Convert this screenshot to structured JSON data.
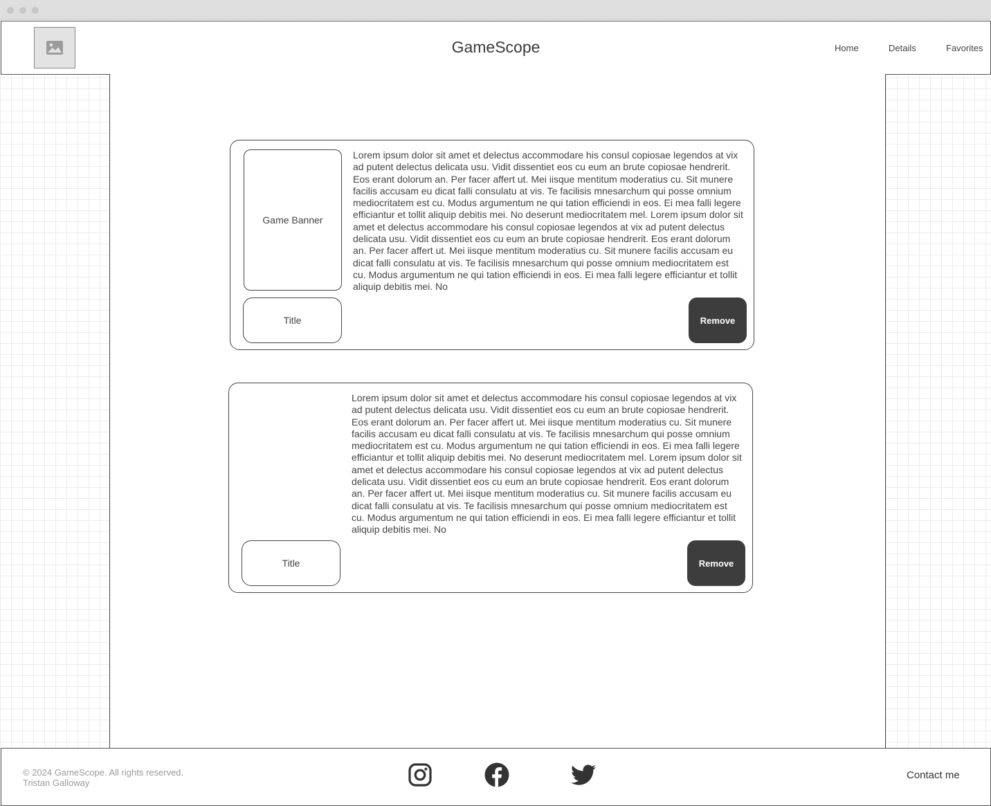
{
  "header": {
    "brand": "GameScope",
    "nav": [
      "Home",
      "Details",
      "Favorites"
    ]
  },
  "cards": [
    {
      "banner_label": "Game Banner",
      "title_label": "Title",
      "description": "Lorem ipsum dolor sit amet et delectus accommodare his consul copiosae legendos at vix ad putent delectus delicata usu. Vidit dissentiet eos cu eum an brute copiosae hendrerit. Eos erant dolorum an. Per facer affert ut. Mei iisque mentitum moderatius cu. Sit munere facilis accusam eu dicat falli consulatu at vis. Te facilisis mnesarchum qui posse omnium mediocritatem est cu. Modus argumentum ne qui tation efficiendi in eos. Ei mea falli legere efficiantur et tollit aliquip debitis mei. No deserunt mediocritatem mel. Lorem ipsum dolor sit amet et delectus accommodare his consul copiosae legendos at vix ad putent delectus delicata usu. Vidit dissentiet eos cu eum an brute copiosae hendrerit. Eos erant dolorum an. Per facer affert ut. Mei iisque mentitum moderatius cu. Sit munere facilis accusam eu dicat falli consulatu at vis. Te facilisis mnesarchum qui posse omnium mediocritatem est cu. Modus argumentum ne qui tation efficiendi in eos. Ei mea falli legere efficiantur et tollit aliquip debitis mei. No",
      "remove_label": "Remove"
    },
    {
      "title_label": "Title",
      "description": "Lorem ipsum dolor sit amet et delectus accommodare his consul copiosae legendos at vix ad putent delectus delicata usu. Vidit dissentiet eos cu eum an brute copiosae hendrerit. Eos erant dolorum an. Per facer affert ut. Mei iisque mentitum moderatius cu. Sit munere facilis accusam eu dicat falli consulatu at vis. Te facilisis mnesarchum qui posse omnium mediocritatem est cu. Modus argumentum ne qui tation efficiendi in eos. Ei mea falli legere efficiantur et tollit aliquip debitis mei. No deserunt mediocritatem mel. Lorem ipsum dolor sit amet et delectus accommodare his consul copiosae legendos at vix ad putent delectus delicata usu. Vidit dissentiet eos cu eum an brute copiosae hendrerit. Eos erant dolorum an. Per facer affert ut. Mei iisque mentitum moderatius cu. Sit munere facilis accusam eu dicat falli consulatu at vis. Te facilisis mnesarchum qui posse omnium mediocritatem est cu. Modus argumentum ne qui tation efficiendi in eos. Ei mea falli legere efficiantur et tollit aliquip debitis mei. No",
      "remove_label": "Remove"
    }
  ],
  "footer": {
    "copyright": "© 2024 GameScope. All rights reserved.",
    "author": "Tristan Galloway",
    "social_icons": [
      "instagram-icon",
      "facebook-icon",
      "twitter-icon"
    ],
    "contact_label": "Contact me"
  },
  "colors": {
    "button_dark": "#3d3d3d",
    "border": "#444444",
    "grid_line": "#ececec",
    "muted_text": "#9a9a9a"
  }
}
